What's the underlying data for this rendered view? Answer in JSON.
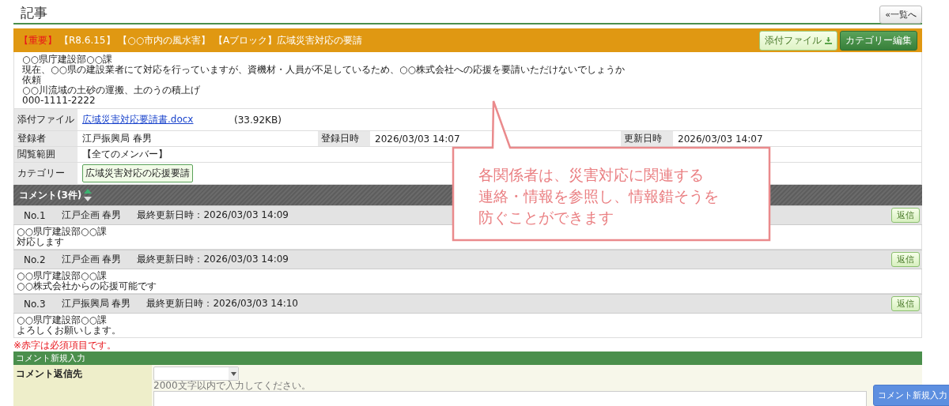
{
  "page_title": "記事",
  "back_button": "«一覧へ",
  "article": {
    "priority": "【重要】",
    "title": "【R8.6.15】 【○○市内の風水害】 【Aブロック】広域災害対応の要請",
    "buttons": [
      {
        "label": "添付ファイル",
        "kind": "download"
      },
      {
        "label": "カテゴリー編集",
        "kind": "edit"
      }
    ],
    "body": [
      "○○県庁建設部○○課",
      "現在、○○県の建設業者にて対応を行っていますが、資機材・人員が不足しているため、○○株式会社への応援を要請いただけないでしょうか",
      "依頼",
      "○○川流域の土砂の運搬、土のうの積上げ",
      "000-1111-2222"
    ],
    "attachment": {
      "label": "添付ファイル",
      "file": "広域災害対応要請書.docx",
      "size": "(33.92KB)"
    },
    "meta": [
      {
        "label": "登録者",
        "value": "江戸振興局 春男"
      },
      {
        "label": "登録日時",
        "value": "2026/03/03 14:07"
      },
      {
        "label": "更新日時",
        "value": "2026/03/03 14:07"
      }
    ],
    "scope": {
      "label": "閲覧範囲",
      "value": "【全てのメンバー】"
    },
    "category": {
      "label": "カテゴリー",
      "tags": [
        "広域災害対応の応援要請"
      ]
    }
  },
  "comments": {
    "title": "コメント(3件)",
    "items": [
      {
        "number": "No.1",
        "author": "江戸企画 春男",
        "updated": "最終更新日時：2026/03/03 14:09",
        "reply": "返信",
        "body": [
          "○○県庁建設部○○課",
          "対応します"
        ]
      },
      {
        "number": "No.2",
        "author": "江戸企画 春男",
        "updated": "最終更新日時：2026/03/03 14:09",
        "reply": "返信",
        "body": [
          "○○県庁建設部○○課",
          "○○株式会社からの応援可能です"
        ]
      },
      {
        "number": "No.3",
        "author": "江戸振興局 春男",
        "updated": "最終更新日時：2026/03/03 14:10",
        "reply": "返信",
        "body": [
          "○○県庁建設部○○課",
          "よろしくお願いします。"
        ]
      }
    ]
  },
  "required_note": "※赤字は必須項目です。",
  "form": {
    "title": "コメント新規入力",
    "reply_to": {
      "label": "コメント返信先"
    },
    "comment": {
      "hint": "2000文字以内で入力してください。"
    }
  },
  "float_button": "コメント新規入力",
  "callout": [
    "各関係者は、災害対応に関連する",
    "連絡・情報を参照し、情報錯そうを",
    "防ぐことができます"
  ]
}
